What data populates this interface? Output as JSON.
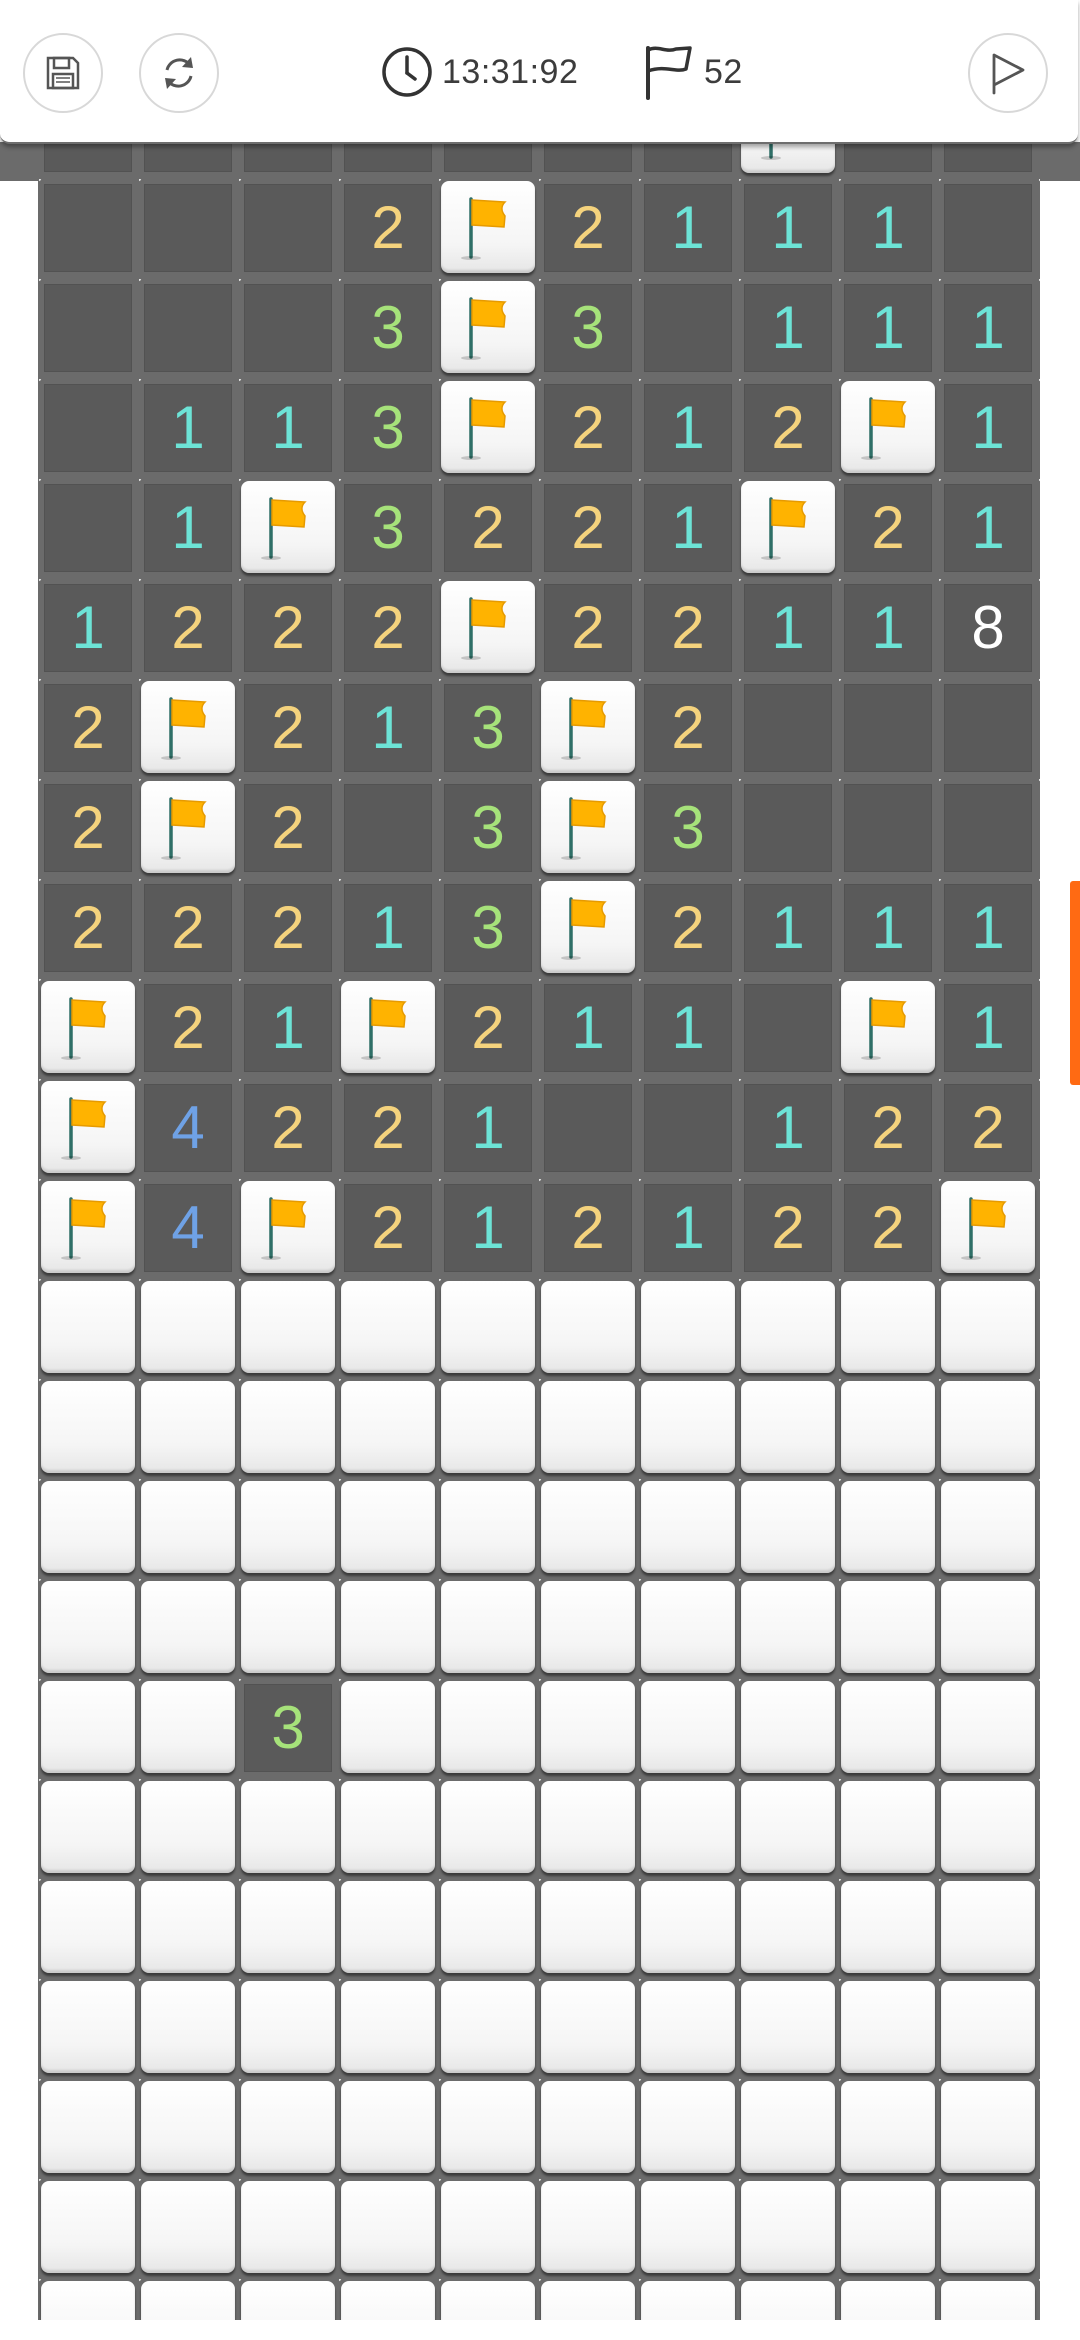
{
  "toolbar": {
    "save_icon": "floppy-disk-icon",
    "restart_icon": "refresh-icon",
    "clock_icon": "clock-icon",
    "timer": "13:31:92",
    "flag_icon": "flag-outline-icon",
    "flags_remaining": "52",
    "finish_icon": "play-triangle-icon"
  },
  "colors": {
    "n1": "#6de3d6",
    "n2": "#f5d37d",
    "n3": "#a6e27a",
    "n4": "#6fa2e6",
    "board": "#6b6b6b",
    "revealed": "#5a5a5a",
    "scroll_thumb": "#ff6a13",
    "flag": "#ffb300"
  },
  "board": {
    "columns": 10,
    "legend": "R = revealed empty, H = hidden, F = flagged, digit = revealed number",
    "rows": [
      "RRRRRRRFRR",
      "RRR2F2111R",
      "RRR3F3R111",
      "R113F212F1",
      "R1F3221F21",
      "1222F22118",
      "2F213F2RRR",
      "2F2R3F3RRR",
      "22213F2111",
      "F21F211.F1",
      "F4221RR122",
      "F4F212122F",
      "HHHHHHHHHH",
      "HHHHHHHHHH",
      "HHHHHHHHHH",
      "HHHHHHHHHH",
      "HH3HHHHHHH",
      "HHHHHHHHHH",
      "HHHHHHHHHH",
      "HHHHHHHHHH",
      "HHHHHHHHHH",
      "HHHHHHHHHH",
      "HHHHHHHHHH"
    ]
  }
}
